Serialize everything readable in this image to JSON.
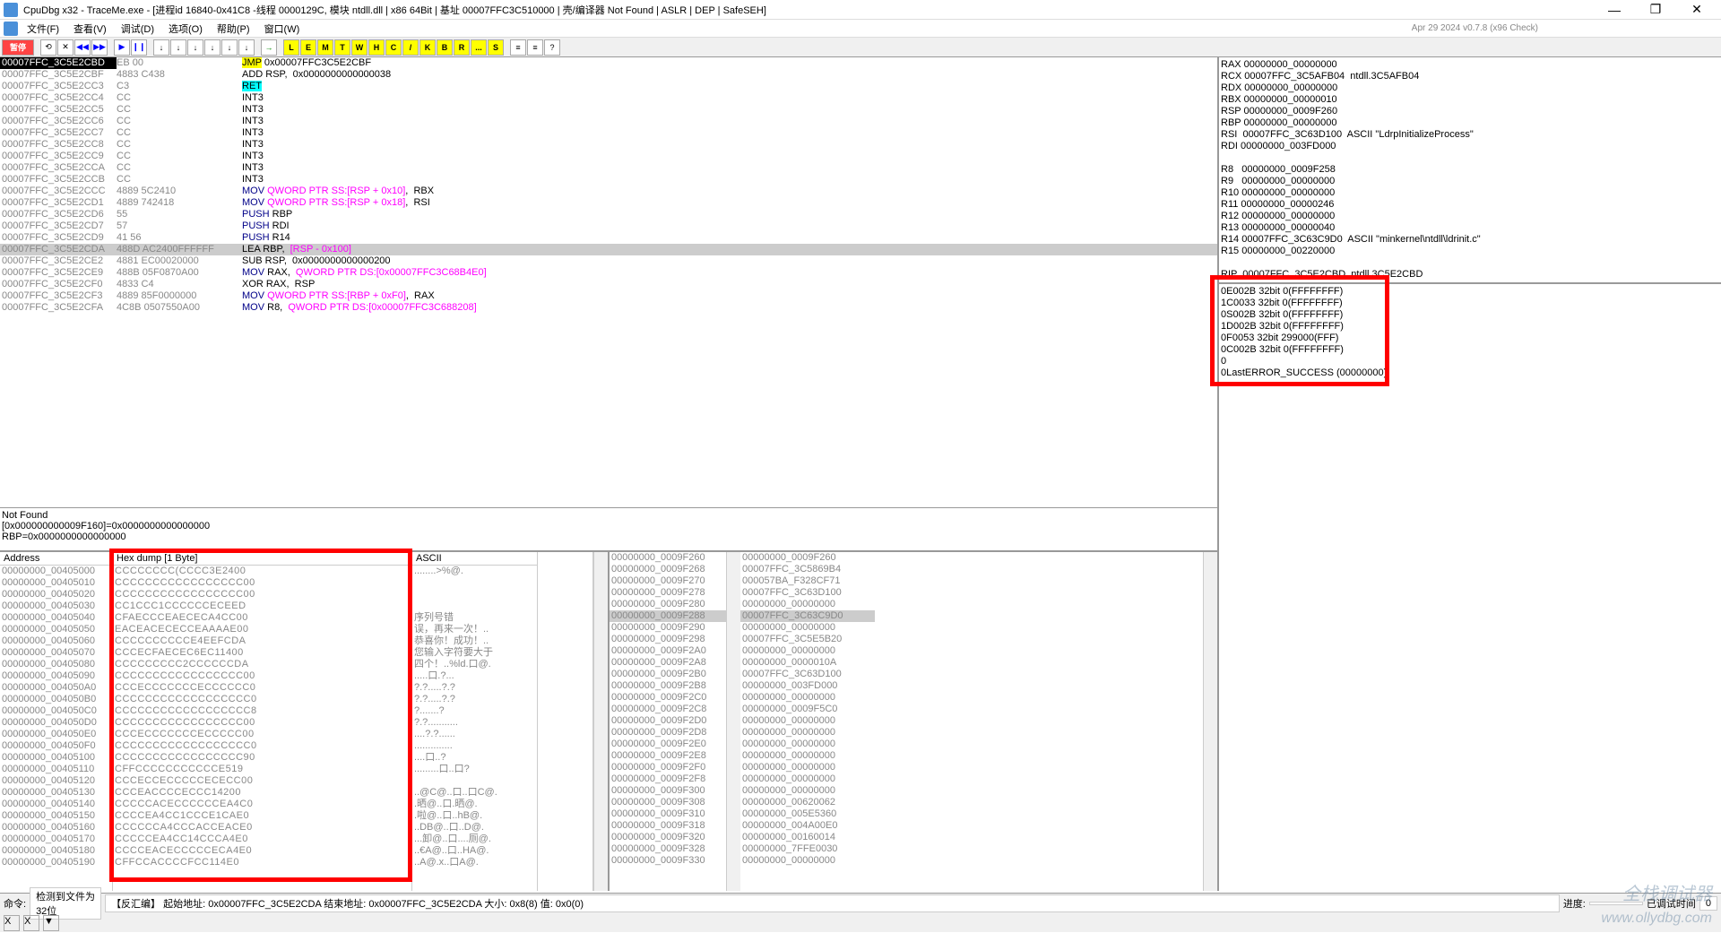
{
  "title": "CpuDbg x32 - TraceMe.exe - [进程id 16840-0x41C8 -线程 0000129C, 模块 ntdll.dll | x86 64Bit | 基址 00007FFC3C510000 | 壳/编译器 Not Found | ASLR | DEP | SafeSEH]",
  "menu": {
    "file": "文件(F)",
    "view": "查看(V)",
    "debug": "调试(D)",
    "option": "选项(O)",
    "help": "帮助(P)",
    "window": "窗口(W)",
    "info": "Apr 29 2024   v0.7.8 (x96 Check)"
  },
  "toolbar": {
    "pause": "暂停",
    "letters": [
      "L",
      "E",
      "M",
      "T",
      "W",
      "H",
      "C",
      "/",
      "K",
      "B",
      "R",
      "...",
      "S"
    ]
  },
  "disasm": [
    {
      "a": "00007FFC_3C5E2CBD",
      "b": "EB 00",
      "m": [
        "",
        "JMP",
        " 0x00007FFC3C5E2CBF"
      ],
      "sel": 1
    },
    {
      "a": "00007FFC_3C5E2CBF",
      "b": "4883 C438",
      "m": [
        "ADD RSP,  0x0000000000000038"
      ]
    },
    {
      "a": "00007FFC_3C5E2CC3",
      "b": "C3",
      "m": [
        "",
        "RET"
      ],
      "ret": 1
    },
    {
      "a": "00007FFC_3C5E2CC4",
      "b": "CC",
      "m": [
        "INT3"
      ]
    },
    {
      "a": "00007FFC_3C5E2CC5",
      "b": "CC",
      "m": [
        "INT3"
      ]
    },
    {
      "a": "00007FFC_3C5E2CC6",
      "b": "CC",
      "m": [
        "INT3"
      ]
    },
    {
      "a": "00007FFC_3C5E2CC7",
      "b": "CC",
      "m": [
        "INT3"
      ]
    },
    {
      "a": "00007FFC_3C5E2CC8",
      "b": "CC",
      "m": [
        "INT3"
      ]
    },
    {
      "a": "00007FFC_3C5E2CC9",
      "b": "CC",
      "m": [
        "INT3"
      ]
    },
    {
      "a": "00007FFC_3C5E2CCA",
      "b": "CC",
      "m": [
        "INT3"
      ]
    },
    {
      "a": "00007FFC_3C5E2CCB",
      "b": "CC",
      "m": [
        "INT3"
      ]
    },
    {
      "a": "00007FFC_3C5E2CCC",
      "b": "4889 5C2410",
      "m": [
        "",
        "MOV ",
        "QWORD PTR SS:[RSP + 0x10]",
        ",  RBX"
      ]
    },
    {
      "a": "00007FFC_3C5E2CD1",
      "b": "4889 742418",
      "m": [
        "",
        "MOV ",
        "QWORD PTR SS:[RSP + 0x18]",
        ",  RSI"
      ]
    },
    {
      "a": "00007FFC_3C5E2CD6",
      "b": "55",
      "m": [
        "",
        "PUSH",
        " RBP"
      ]
    },
    {
      "a": "00007FFC_3C5E2CD7",
      "b": "57",
      "m": [
        "",
        "PUSH",
        " RDI"
      ]
    },
    {
      "a": "00007FFC_3C5E2CD9",
      "b": "41 56",
      "m": [
        "",
        "PUSH",
        " R14"
      ]
    },
    {
      "a": "00007FFC_3C5E2CDA",
      "b": "488D AC2400FFFFFF",
      "m": [
        "LEA RBP,  ",
        "[RSP - 0x100]"
      ],
      "sel2": 1
    },
    {
      "a": "00007FFC_3C5E2CE2",
      "b": "4881 EC00020000",
      "m": [
        "SUB RSP,  0x0000000000000200"
      ]
    },
    {
      "a": "00007FFC_3C5E2CE9",
      "b": "488B 05F0870A00",
      "m": [
        "",
        "MOV",
        " RAX,  ",
        "QWORD PTR DS:[0x00007FFC3C68B4E0]"
      ]
    },
    {
      "a": "00007FFC_3C5E2CF0",
      "b": "4833 C4",
      "m": [
        "XOR RAX,  RSP"
      ]
    },
    {
      "a": "00007FFC_3C5E2CF3",
      "b": "4889 85F0000000",
      "m": [
        "",
        "MOV ",
        "QWORD PTR SS:[RBP + 0xF0]",
        ",  RAX"
      ]
    },
    {
      "a": "00007FFC_3C5E2CFA",
      "b": "4C8B 0507550A00",
      "m": [
        "",
        "MOV",
        " R8,  ",
        "QWORD PTR DS:[0x00007FFC3C688208]"
      ]
    }
  ],
  "info_pane": [
    "Not Found",
    "[0x000000000009F160]=0x0000000000000000",
    "RBP=0x0000000000000000"
  ],
  "regs": [
    "RAX 00000000_00000000",
    "RCX 00007FFC_3C5AFB04  ntdll.3C5AFB04",
    "RDX 00000000_00000000",
    "RBX 00000000_00000010",
    "RSP 00000000_0009F260",
    "RBP 00000000_00000000",
    "RSI  00007FFC_3C63D100  ASCII \"LdrpInitializeProcess\"",
    "RDI 00000000_003FD000",
    "",
    "R8   00000000_0009F258",
    "R9   00000000_00000000",
    "R10 00000000_00000000",
    "R11 00000000_00000246",
    "R12 00000000_00000000",
    "R13 00000000_00000040",
    "R14 00007FFC_3C63C9D0  ASCII \"minkernel\\ntdll\\ldrinit.c\"",
    "R15 00000000_00220000",
    "",
    "RIP  00007FFC_3C5E2CBD  ntdll.3C5E2CBD"
  ],
  "segs": [
    "  0E002B 32bit 0(FFFFFFFF)",
    "  1C0033 32bit 0(FFFFFFFF)",
    "  0S002B 32bit 0(FFFFFFFF)",
    "  1D002B 32bit 0(FFFFFFFF)",
    "  0F0053 32bit 299000(FFF)",
    "  0C002B 32bit 0(FFFFFFFF)",
    "  0",
    "  0LastERROR_SUCCESS (00000000)"
  ],
  "dump_hdr": {
    "addr": "Address",
    "hex": "Hex dump [1 Byte]",
    "asc": "ASCII"
  },
  "dump_addr": [
    "00000000_00405000",
    "00000000_00405010",
    "00000000_00405020",
    "00000000_00405030",
    "00000000_00405040",
    "00000000_00405050",
    "00000000_00405060",
    "00000000_00405070",
    "00000000_00405080",
    "00000000_00405090",
    "00000000_004050A0",
    "00000000_004050B0",
    "00000000_004050C0",
    "00000000_004050D0",
    "00000000_004050E0",
    "00000000_004050F0",
    "00000000_00405100",
    "00000000_00405110",
    "00000000_00405120",
    "00000000_00405130",
    "00000000_00405140",
    "00000000_00405150",
    "00000000_00405160",
    "00000000_00405170",
    "00000000_00405180",
    "00000000_00405190"
  ],
  "dump_hex": [
    "CCCCCCCC(CCCC3E2400",
    "CCCCCCCCCCCCCCCCC00",
    "CCCCCCCCCCCCCCCCC00",
    "CC1CCC1CCCCCCECEED",
    "CFAECCCEAECECA4CC00",
    "EACEACECECCEAAAAE00",
    "CCCCCCCCCCE4EEFCDA",
    "CCCECFAECEC6EC11400",
    "CCCCCCCCC2CCCCCCDA",
    "CCCCCCCCCCCCCCCCC00",
    "CCCECCCCCCCECCCCCC0",
    "CCCCCCCCCCCCCCCCCC0",
    "CCCCCCCCCCCCCCCCCC8",
    "CCCCCCCCCCCCCCCCC00",
    "CCCECCCCCCCECCCCC00",
    "CCCCCCCCCCCCCCCCCC0",
    "CCCCCCCCCCCCCCCCC90",
    "CFFCCCCCCCCCCCE519",
    "CCCECCECCCCCECECC00",
    "CCCEACCCCECCC14200",
    "CCCCCACECCCCCCEA4C0",
    "CCCCEA4CC1CCCE1CAE0",
    "CCCCCCA4CCCACCEACE0",
    "CCCCCEA4CC14CCCA4E0",
    "CCCCEACECCCCCECA4E0",
    "CFFCCACCCCFCC114E0"
  ],
  "dump_asc": [
    "........>%@.",
    "",
    "",
    "",
    "序列号错",
    "误，再来一次！..",
    "恭喜你！成功！..",
    "您输入字符要大于",
    "四个！..%ld.口@.",
    ".....口.?...",
    "?.?.....?.?",
    "?.?.....?.?",
    "?.......?",
    "?.?...........",
    "....?.?......",
    "..............",
    "....口..?",
    ".........口..口?",
    "",
    "..@C@..口..口C@.",
    ".晒@..口.晒@.",
    ".啦@..口..hB@.",
    "..DB@..口..D@.",
    "...卸@..口....厕@.",
    "..€A@..口..HA@.",
    "..A@.x..口A@."
  ],
  "stack_a": [
    "00000000_0009F260",
    "00000000_0009F268",
    "00000000_0009F270",
    "00000000_0009F278",
    "00000000_0009F280",
    "00000000_0009F288",
    "00000000_0009F290",
    "00000000_0009F298",
    "00000000_0009F2A0",
    "00000000_0009F2A8",
    "00000000_0009F2B0",
    "00000000_0009F2B8",
    "00000000_0009F2C0",
    "00000000_0009F2C8",
    "00000000_0009F2D0",
    "00000000_0009F2D8",
    "00000000_0009F2E0",
    "00000000_0009F2E8",
    "00000000_0009F2F0",
    "00000000_0009F2F8",
    "00000000_0009F300",
    "00000000_0009F308",
    "00000000_0009F310",
    "00000000_0009F318",
    "00000000_0009F320",
    "00000000_0009F328",
    "00000000_0009F330"
  ],
  "stack_v": [
    "00000000_0009F260",
    "00007FFC_3C5869B4",
    "000057BA_F328CF71",
    "00007FFC_3C63D100",
    "00000000_00000000",
    "00007FFC_3C63C9D0",
    "00000000_00000000",
    "00007FFC_3C5E5B20",
    "00000000_00000000",
    "00000000_0000010A",
    "00007FFC_3C63D100",
    "00000000_003FD000",
    "00000000_00000000",
    "00000000_0009F5C0",
    "00000000_00000000",
    "00000000_00000000",
    "00000000_00000000",
    "00000000_00000000",
    "00000000_00000000",
    "00000000_00000000",
    "00000000_00000000",
    "00000000_00620062",
    "00000000_005E5360",
    "00000000_004A00E0",
    "00000000_00160014",
    "00000000_7FFE0030",
    "00000000_00000000"
  ],
  "status": {
    "cmd": "命令:",
    "detect": "检测到文件为 32位",
    "anti": "【反汇编】 起始地址: 0x00007FFC_3C5E2CDA 结束地址: 0x00007FFC_3C5E2CDA 大小: 0x8(8) 值: 0x0(0)",
    "progress": "进度:",
    "debugtime": "已调试时间",
    "zero": "0"
  },
  "watermark": "全栈调试器",
  "watermark2": "www.ollydbg.com"
}
